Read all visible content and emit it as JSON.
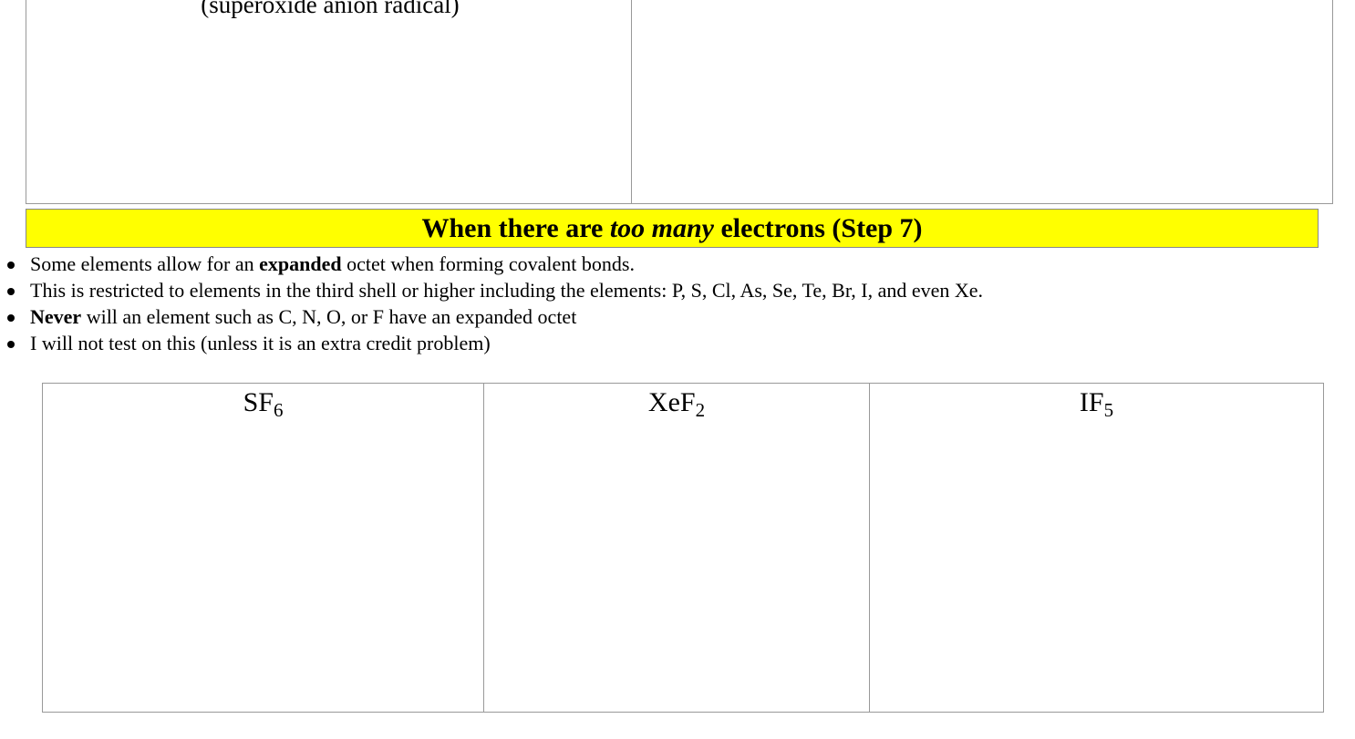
{
  "top_table": {
    "caption": "(superoxide anion radical)"
  },
  "banner": {
    "part1": "When there are ",
    "part2_italic": "too many",
    "part3": " electrons (Step 7)",
    "background_color": "#ffff00"
  },
  "bullets": [
    {
      "pre": "Some elements allow for an ",
      "bold": "expanded",
      "post": " octet when forming covalent bonds."
    },
    {
      "pre": "This is restricted to elements in the third shell or higher including the elements: P, S, Cl, As, Se, Te, Br, I, and even Xe.",
      "bold": "",
      "post": ""
    },
    {
      "pre": "",
      "bold": "Never",
      "post": " will an element such as C, N, O, or F have an expanded octet"
    },
    {
      "pre": "I will not test on this (unless it is an extra credit problem)",
      "bold": "",
      "post": ""
    }
  ],
  "molecules": [
    {
      "formula": "SF",
      "subscript": "6"
    },
    {
      "formula": "XeF",
      "subscript": "2"
    },
    {
      "formula": "IF",
      "subscript": "5"
    }
  ]
}
